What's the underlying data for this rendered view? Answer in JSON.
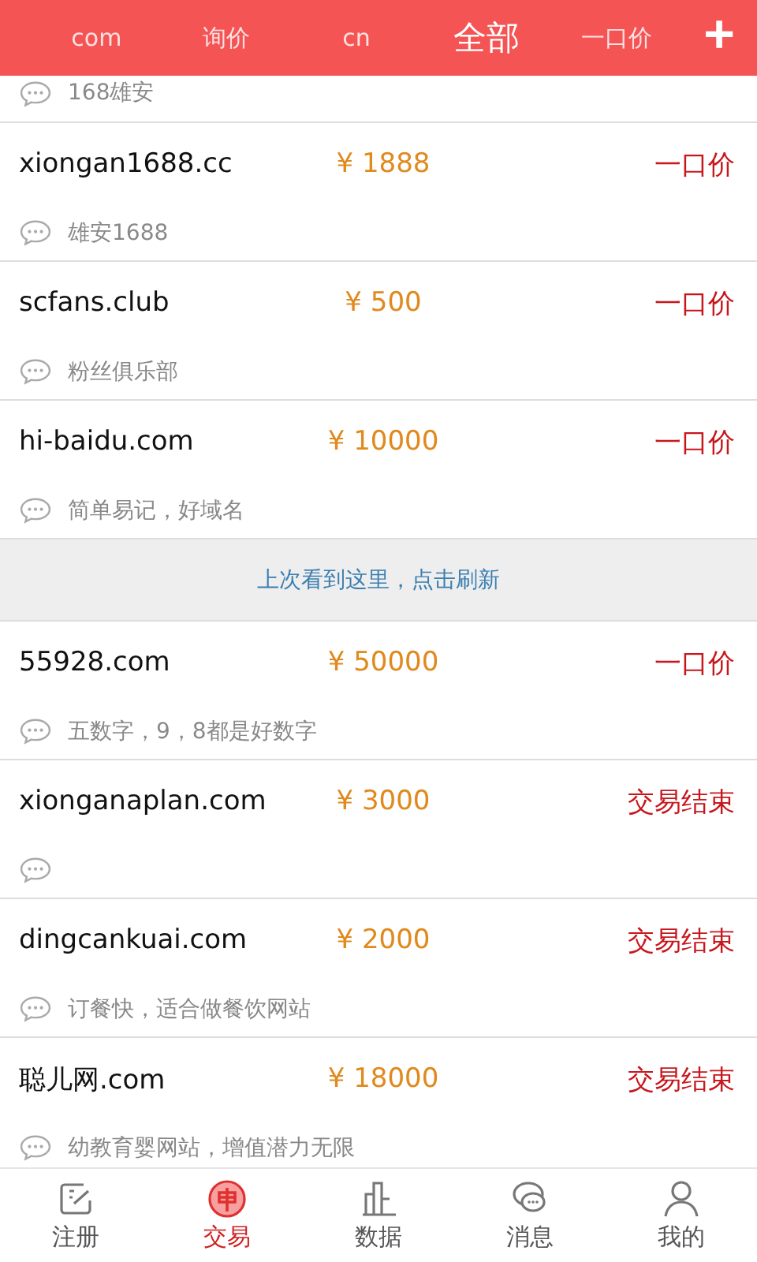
{
  "header": {
    "tabs": [
      {
        "label": "com",
        "selected": false
      },
      {
        "label": "询价",
        "selected": false
      },
      {
        "label": "cn",
        "selected": false
      },
      {
        "label": "全部",
        "selected": true
      },
      {
        "label": "一口价",
        "selected": false
      }
    ],
    "add_button": "+"
  },
  "listings": [
    {
      "kind": "partial",
      "note": "168雄安"
    },
    {
      "kind": "item",
      "domain": "xiongan1688.cc",
      "price": "¥ 1888",
      "status": "一口价",
      "note": "雄安1688"
    },
    {
      "kind": "item",
      "domain": "scfans.club",
      "price": "¥ 500",
      "status": "一口价",
      "note": "粉丝俱乐部"
    },
    {
      "kind": "item",
      "domain": "hi-baidu.com",
      "price": "¥ 10000",
      "status": "一口价",
      "note": "简单易记，好域名"
    },
    {
      "kind": "banner",
      "text": "上次看到这里，点击刷新"
    },
    {
      "kind": "item",
      "domain": "55928.com",
      "price": "¥ 50000",
      "status": "一口价",
      "note": "五数字，9，8都是好数字"
    },
    {
      "kind": "item",
      "domain": "xionganaplan.com",
      "price": "¥ 3000",
      "status": "交易结束"
    },
    {
      "kind": "item",
      "domain": "dingcankuai.com",
      "price": "¥ 2000",
      "status": "交易结束",
      "note": "订餐快，适合做餐饮网站"
    },
    {
      "kind": "item",
      "domain": "聪儿网.com",
      "price": "¥ 18000",
      "status": "交易结束",
      "note": "幼教育婴网站，增值潜力无限"
    }
  ],
  "bottom_nav": [
    {
      "label": "注册",
      "selected": false
    },
    {
      "label": "交易",
      "selected": true
    },
    {
      "label": "数据",
      "selected": false
    },
    {
      "label": "消息",
      "selected": false
    },
    {
      "label": "我的",
      "selected": false
    }
  ]
}
